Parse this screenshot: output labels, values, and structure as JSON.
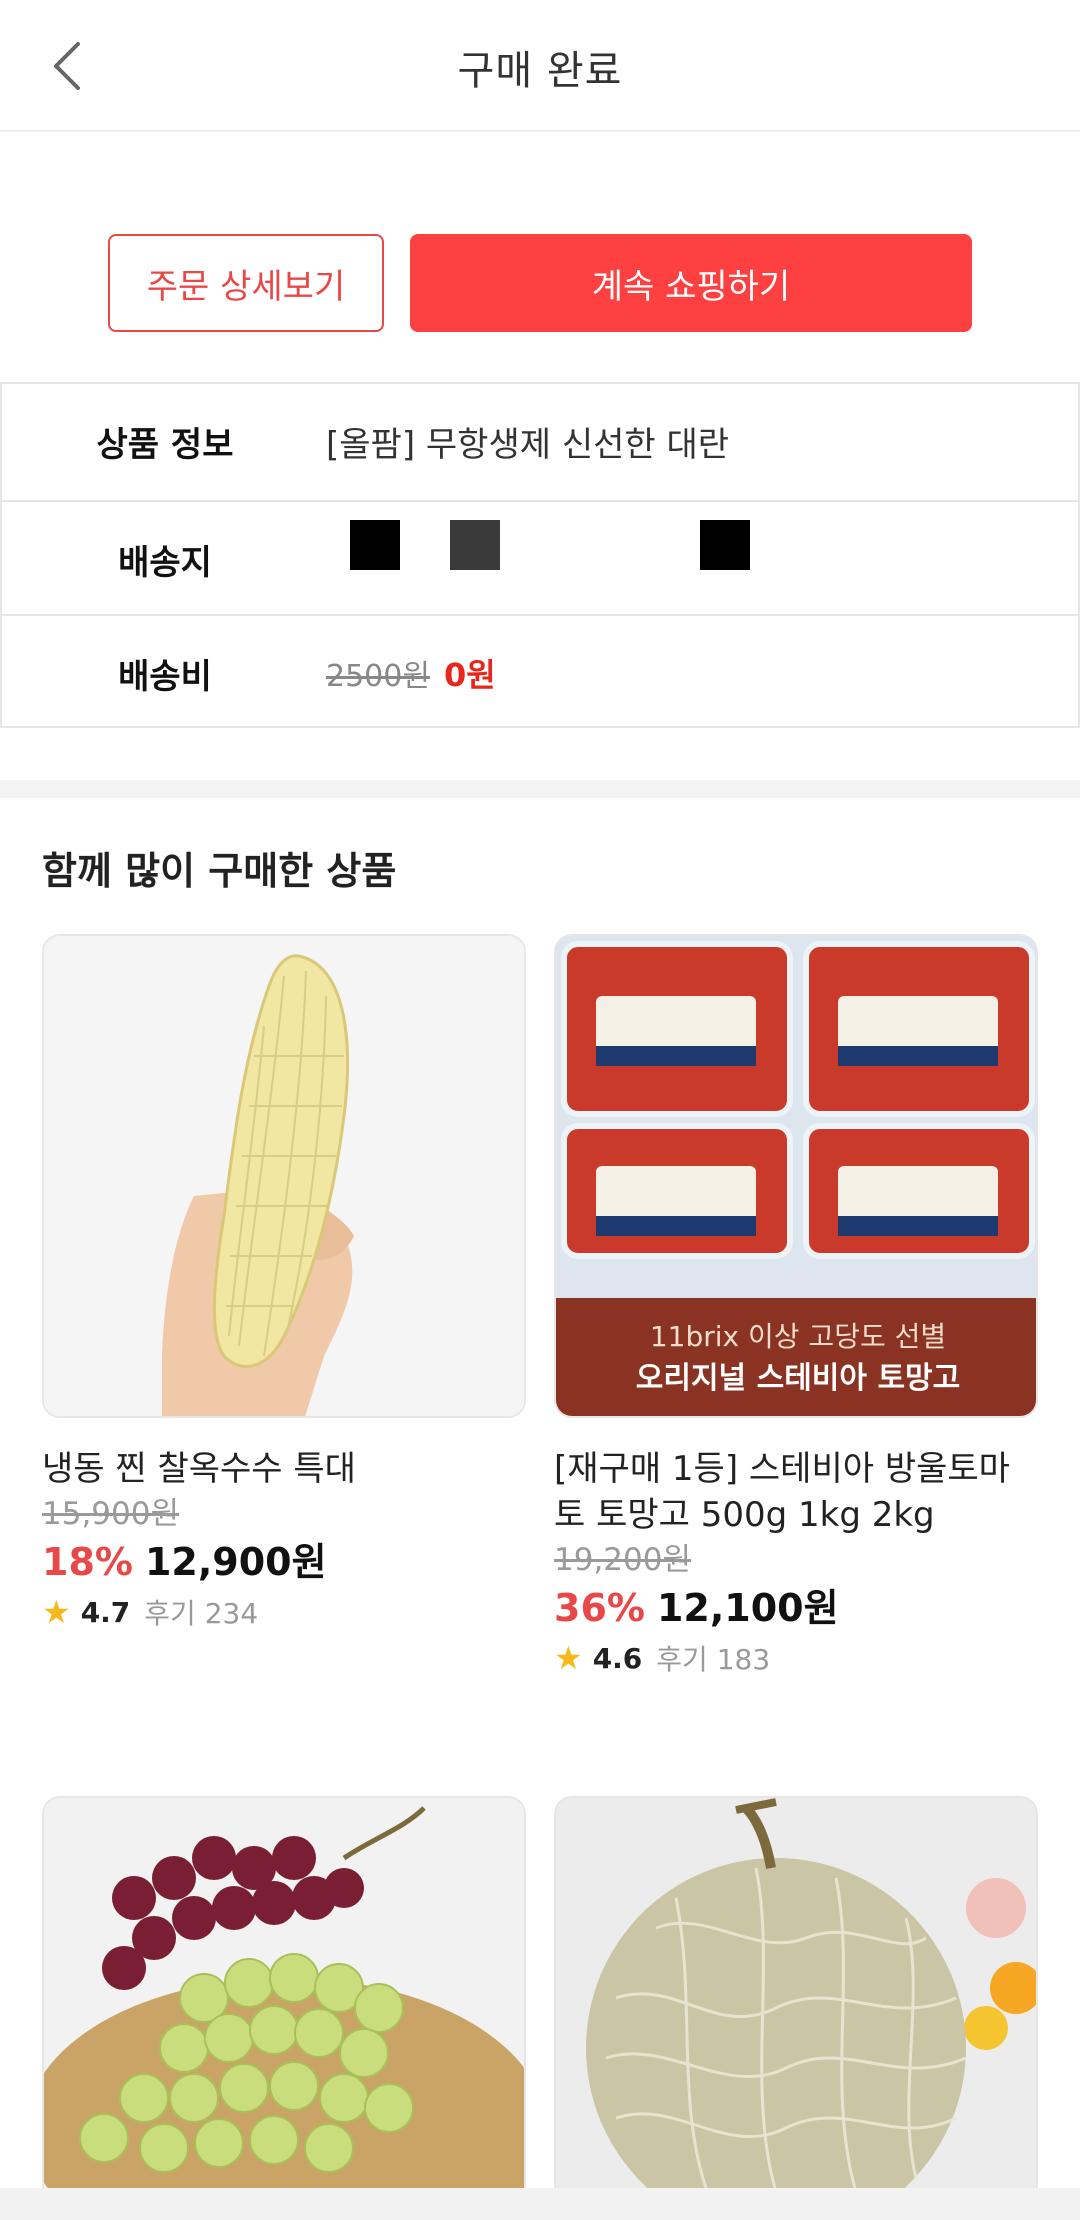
{
  "header": {
    "title": "구매 완료"
  },
  "actions": {
    "order_detail_label": "주문 상세보기",
    "continue_shopping_label": "계속 쇼핑하기"
  },
  "order_info": {
    "product_label": "상품 정보",
    "product_value": "[올팜] 무항생제 신선한 대란",
    "address_label": "배송지",
    "shipping_label": "배송비",
    "shipping_original": "2500원",
    "shipping_final": "0원"
  },
  "recommend": {
    "title": "함께 많이 구매한 상품",
    "products": [
      {
        "name": "냉동 찐 찰옥수수 특대",
        "original_price": "15,900원",
        "discount": "18%",
        "price": "12,900원",
        "rating": "4.7",
        "reviews": "후기 234"
      },
      {
        "name": "[재구매 1등] 스테비아 방울토마토 토망고 500g 1kg 2kg",
        "original_price": "19,200원",
        "discount": "36%",
        "price": "12,100원",
        "rating": "4.6",
        "reviews": "후기 183",
        "banner_line1": "11brix 이상 고당도 선별",
        "banner_line2": "오리지널 스테비아 토망고"
      },
      {
        "name": "",
        "image": "grapes"
      },
      {
        "name": "",
        "image": "melon"
      }
    ]
  },
  "colors": {
    "accent_red": "#ff4040",
    "discount_red": "#e94848",
    "star": "#f6b91c"
  }
}
